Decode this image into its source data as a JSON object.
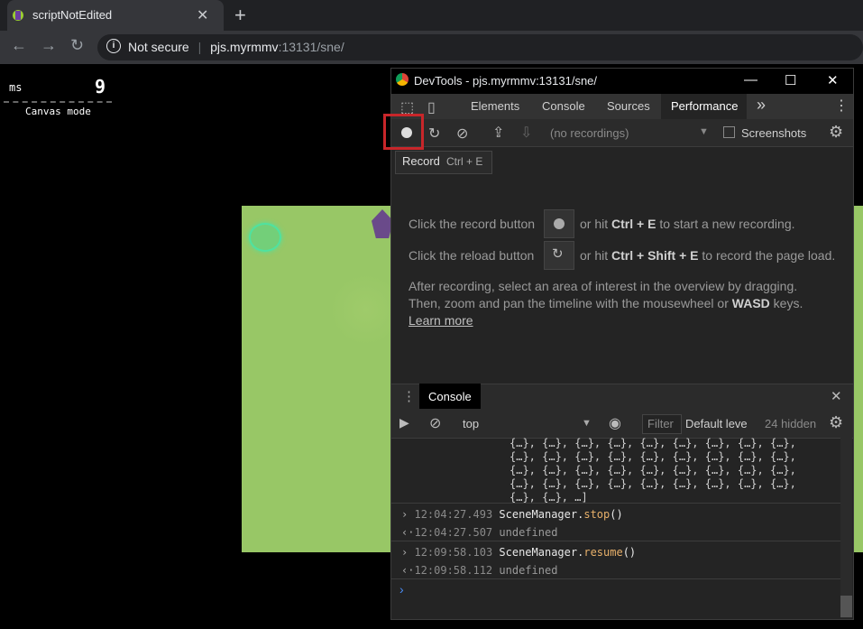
{
  "browser": {
    "tab_title": "scriptNotEdited",
    "tab_close": "✕",
    "new_tab": "+",
    "back": "←",
    "forward": "→",
    "reload": "↻",
    "security_label": "Not secure",
    "url_host": "pjs.myrmmv",
    "url_rest": ":13131/sne/"
  },
  "page": {
    "fps_unit": "ms",
    "fps_value": "9",
    "canvas_mode": "Canvas mode"
  },
  "devtools": {
    "title": "DevTools - pjs.myrmmv:13131/sne/",
    "window_min": "—",
    "window_max": "☐",
    "window_close": "✕",
    "tabs": [
      "Elements",
      "Console",
      "Sources",
      "Performance"
    ],
    "more_tabs": "»",
    "menu": "⋮",
    "recordings_select": "(no recordings)",
    "screenshots_label": "Screenshots",
    "tooltip_label": "Record",
    "tooltip_shortcut": "Ctrl + E",
    "info": {
      "record_prefix": "Click the record button",
      "record_middle": "or hit",
      "record_key": "Ctrl + E",
      "record_suffix": "to start a new recording.",
      "reload_prefix": "Click the reload button",
      "reload_middle": "or hit",
      "reload_key": "Ctrl + Shift + E",
      "reload_suffix": "to record the page load.",
      "after_line1": "After recording, select an area of interest in the overview by dragging.",
      "after_line2_a": "Then, zoom and pan the timeline with the mousewheel or",
      "after_line2_key": "WASD",
      "after_line2_b": "keys.",
      "learn_more": "Learn more"
    },
    "drawer": {
      "tab_label": "Console",
      "close": "✕",
      "context": "top",
      "filter_placeholder": "Filter",
      "level": "Default leve",
      "hidden": "24 hidden",
      "object_dump": "{…}, {…}, {…}, {…}, {…}, {…}, {…}, {…}, {…},\n{…}, {…}, {…}, {…}, {…}, {…}, {…}, {…}, {…},\n{…}, {…}, {…}, {…}, {…}, {…}, {…}, {…}, {…},\n{…}, {…}, {…}, {…}, {…}, {…}, {…}, {…}, {…},\n{…}, {…}, …]",
      "entries": [
        {
          "time": "12:04:27.493",
          "obj": "SceneManager",
          "method": "stop",
          "args": "()",
          "result_time": "12:04:27.507",
          "result": "undefined"
        },
        {
          "time": "12:09:58.103",
          "obj": "SceneManager",
          "method": "resume",
          "args": "()",
          "result_time": "12:09:58.112",
          "result": "undefined"
        }
      ],
      "prompt": "›"
    }
  }
}
